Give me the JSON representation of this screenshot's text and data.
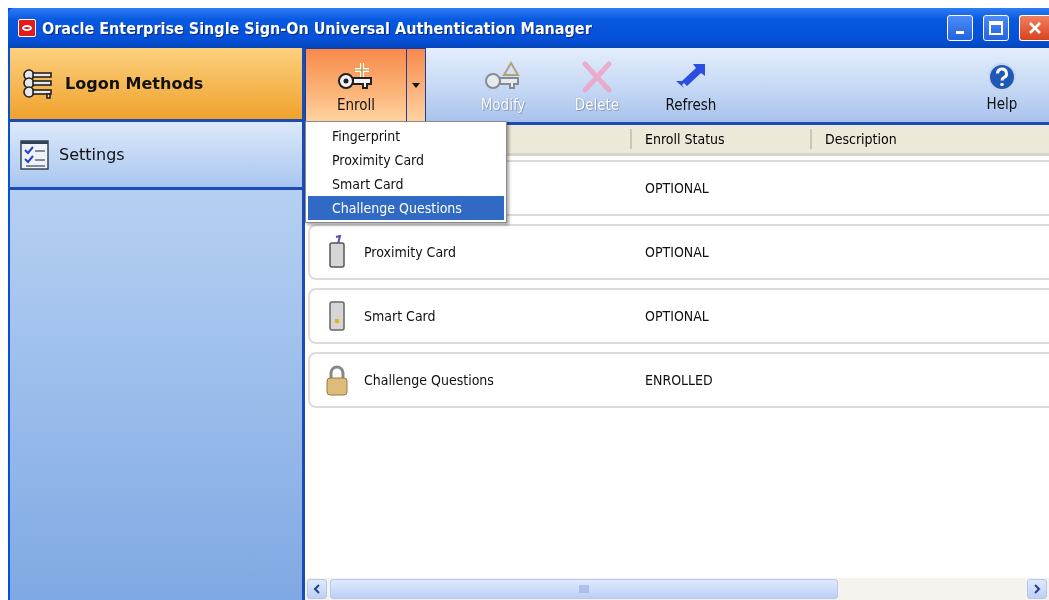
{
  "window": {
    "title": "Oracle Enterprise Single Sign-On Universal Authentication Manager"
  },
  "sidebar": {
    "items": [
      {
        "label": "Logon Methods",
        "kind": "keys",
        "selected": true
      },
      {
        "label": "Settings",
        "kind": "checklist",
        "selected": false
      }
    ]
  },
  "toolbar": {
    "buttons": [
      {
        "label": "Enroll",
        "kind": "enroll",
        "disabled": false,
        "active": true
      },
      {
        "label": "Modify",
        "kind": "modify",
        "disabled": true,
        "active": false
      },
      {
        "label": "Delete",
        "kind": "delete",
        "disabled": true,
        "active": false
      },
      {
        "label": "Refresh",
        "kind": "refresh",
        "disabled": false,
        "active": false
      },
      {
        "label": "Help",
        "kind": "help",
        "disabled": false,
        "active": false
      }
    ]
  },
  "enroll_menu": {
    "items": [
      {
        "label": "Fingerprint",
        "selected": false
      },
      {
        "label": "Proximity Card",
        "selected": false
      },
      {
        "label": "Smart Card",
        "selected": false
      },
      {
        "label": "Challenge Questions",
        "selected": true
      }
    ]
  },
  "table": {
    "columns": [
      "Enroll Status",
      "Description"
    ],
    "rows": [
      {
        "status": "OPTIONAL"
      },
      {
        "name": "Proximity Card",
        "kind": "proximity",
        "status": "OPTIONAL"
      },
      {
        "name": "Smart Card",
        "kind": "smartcard",
        "status": "OPTIONAL"
      },
      {
        "name": "Challenge Questions",
        "kind": "lock",
        "status": "ENROLLED"
      }
    ]
  }
}
